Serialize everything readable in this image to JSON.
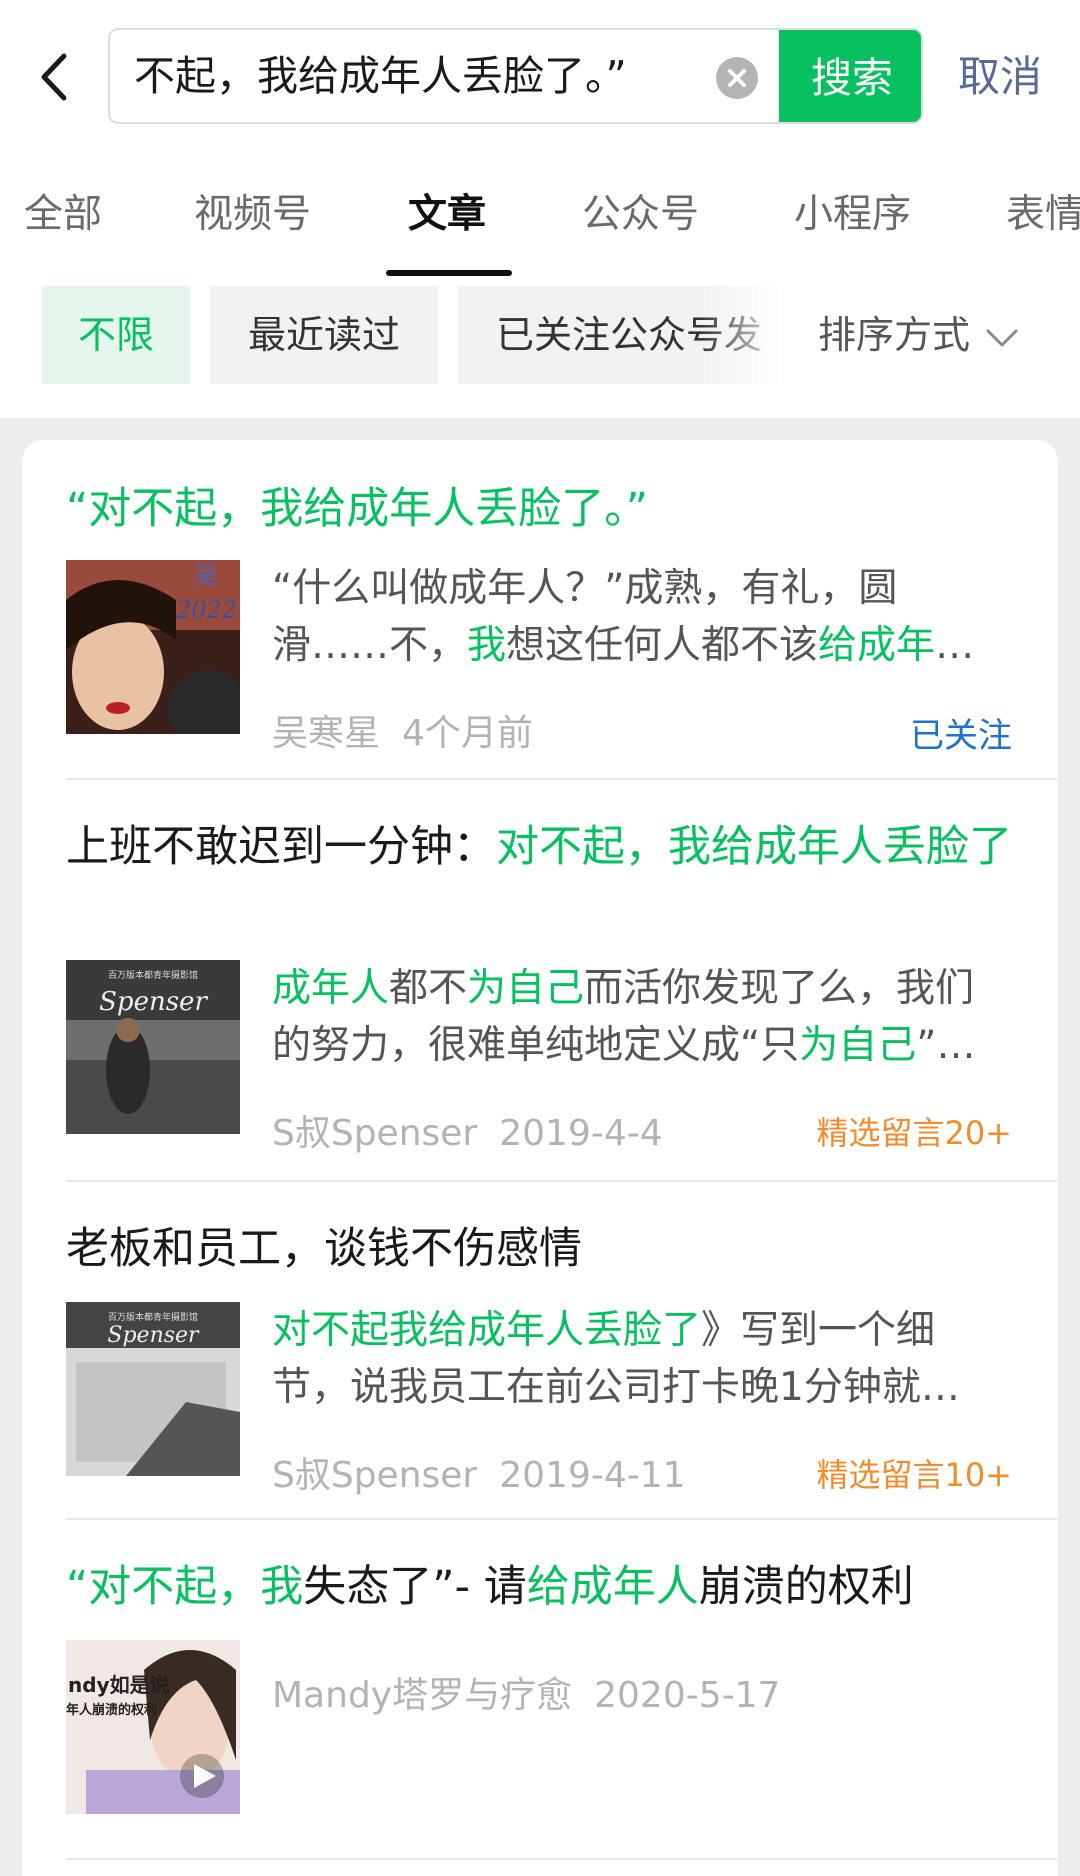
{
  "search": {
    "query": "不起，我给成年人丢脸了。”",
    "button_label": "搜索",
    "cancel_label": "取消"
  },
  "tabs": [
    {
      "label": "全部"
    },
    {
      "label": "视频号"
    },
    {
      "label": "文章"
    },
    {
      "label": "公众号"
    },
    {
      "label": "小程序"
    },
    {
      "label": "表情"
    }
  ],
  "active_tab": "文章",
  "filters": {
    "chips": [
      {
        "label": "不限"
      },
      {
        "label": "最近读过"
      },
      {
        "label": "已关注公众号发"
      }
    ],
    "sort_label": "排序方式"
  },
  "results": [
    {
      "title": [
        "“",
        "对不起，我给成年人丢脸了。”"
      ],
      "snippet": [
        "“什么叫做成年人？”成熟，有礼，圆滑……不，",
        "我",
        "想这任何人都不该",
        "给成年",
        "…"
      ],
      "author": "吴寒星",
      "date": "4个月前",
      "tag": "已关注",
      "thumb_text": [
        "吴",
        "2022."
      ]
    },
    {
      "title": [
        "上班不敢迟到一分钟：",
        "对不起，我给成年人丢脸了"
      ],
      "snippet": [
        "成年人",
        "都不",
        "为自己",
        "而活你发现了么，我们的努力，很难单纯地定义成“只",
        "为自己",
        "”…"
      ],
      "author": "S叔Spenser",
      "date": "2019-4-4",
      "tag": "精选留言20+",
      "thumb_text": [
        "百万版本都青年摄影馆",
        "Spenser"
      ]
    },
    {
      "title": [
        "老板和员工，谈钱不伤感情"
      ],
      "snippet": [
        "对不起我给成年人丢脸了",
        "》写到一个细节，说我员工在前公司打卡晚1分钟就…"
      ],
      "author": "S叔Spenser",
      "date": "2019-4-11",
      "tag": "精选留言10+",
      "thumb_text": [
        "百万版本都青年摄影馆",
        "Spenser"
      ]
    },
    {
      "title": [
        "“对不起，我",
        "失态了”- 请",
        "给成年人",
        "崩溃的权利"
      ],
      "author": "Mandy塔罗与疗愈",
      "date": "2020-5-17",
      "thumb_text": [
        "ndy如是说",
        "年人崩溃的权利"
      ]
    }
  ],
  "colors": {
    "accent_green": "#07c160",
    "link_blue": "#576b95",
    "follow_blue": "#1e72c8",
    "comment_orange": "#f08c2c"
  }
}
